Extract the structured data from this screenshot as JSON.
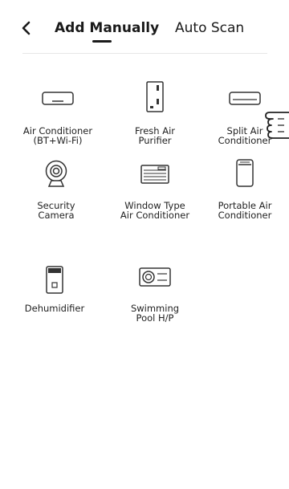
{
  "header": {
    "tabs": [
      {
        "label": "Add Manually",
        "active": true
      },
      {
        "label": "Auto Scan",
        "active": false
      }
    ]
  },
  "devices": [
    {
      "label": "Air Conditioner\n(BT+Wi-Fi)",
      "icon": "air-conditioner-icon"
    },
    {
      "label": "Fresh Air\nPurifier",
      "icon": "fresh-air-purifier-icon"
    },
    {
      "label": "Split Air\nConditioner",
      "icon": "split-air-conditioner-icon"
    },
    {
      "label": "Security\nCamera",
      "icon": "security-camera-icon"
    },
    {
      "label": "Window Type\nAir Conditioner",
      "icon": "window-type-ac-icon"
    },
    {
      "label": "Portable Air\nConditioner",
      "icon": "portable-ac-icon"
    },
    {
      "label": "Dehumidifier",
      "icon": "dehumidifier-icon"
    },
    {
      "label": "Swimming\nPool H/P",
      "icon": "pool-heat-pump-icon"
    }
  ],
  "colors": {
    "text": "#222222",
    "divider": "#e6e6e6",
    "icon_stroke": "#333333",
    "background": "#ffffff"
  }
}
